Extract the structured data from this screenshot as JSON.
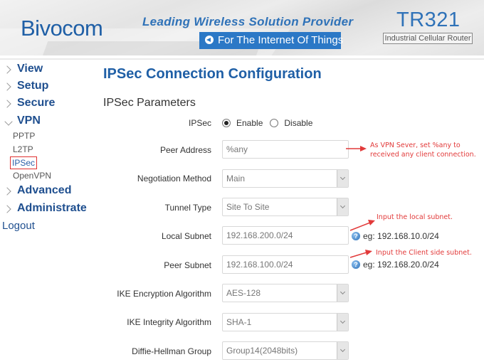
{
  "header": {
    "logo": "Bivocom",
    "tagline": "Leading Wireless Solution Provider",
    "iot_badge": "For The Internet Of Things",
    "model": "TR321",
    "model_subtitle": "Industrial Cellular Router",
    "brand_color": "#1f5fa6",
    "badge_color": "#2b78c6"
  },
  "sidebar": {
    "items": [
      {
        "label": "View",
        "expanded": false
      },
      {
        "label": "Setup",
        "expanded": false
      },
      {
        "label": "Secure",
        "expanded": false
      },
      {
        "label": "VPN",
        "expanded": true
      },
      {
        "label": "Advanced",
        "expanded": false
      },
      {
        "label": "Administrate",
        "expanded": false
      }
    ],
    "vpn_subitems": [
      {
        "label": "PPTP",
        "active": false
      },
      {
        "label": "L2TP",
        "active": false
      },
      {
        "label": "IPSec",
        "active": true
      },
      {
        "label": "OpenVPN",
        "active": false
      }
    ],
    "logout": "Logout"
  },
  "main": {
    "page_title": "IPSec Connection Configuration",
    "section_title": "IPSec Parameters",
    "ipsec": {
      "label": "IPSec",
      "options": [
        "Enable",
        "Disable"
      ],
      "selected": "Enable"
    },
    "fields": {
      "peer_address": {
        "label": "Peer Address",
        "value": "%any"
      },
      "negotiation_method": {
        "label": "Negotiation Method",
        "value": "Main"
      },
      "tunnel_type": {
        "label": "Tunnel Type",
        "value": "Site To Site"
      },
      "local_subnet": {
        "label": "Local Subnet",
        "value": "192.168.200.0/24",
        "hint": "eg: 192.168.10.0/24"
      },
      "peer_subnet": {
        "label": "Peer Subnet",
        "value": "192.168.100.0/24",
        "hint": "eg: 192.168.20.0/24"
      },
      "ike_encryption": {
        "label": "IKE Encryption Algorithm",
        "value": "AES-128"
      },
      "ike_integrity": {
        "label": "IKE Integrity Algorithm",
        "value": "SHA-1"
      },
      "dh_group": {
        "label": "Diffie-Hellman Group",
        "value": "Group14(2048bits)"
      }
    }
  },
  "annotations": {
    "peer_address_line1": "As VPN Sever, set %any to",
    "peer_address_line2": "received any client connection.",
    "local_subnet": "Input the local subnet.",
    "peer_subnet": "Input the Client side subnet.",
    "color": "#e23a3a"
  }
}
